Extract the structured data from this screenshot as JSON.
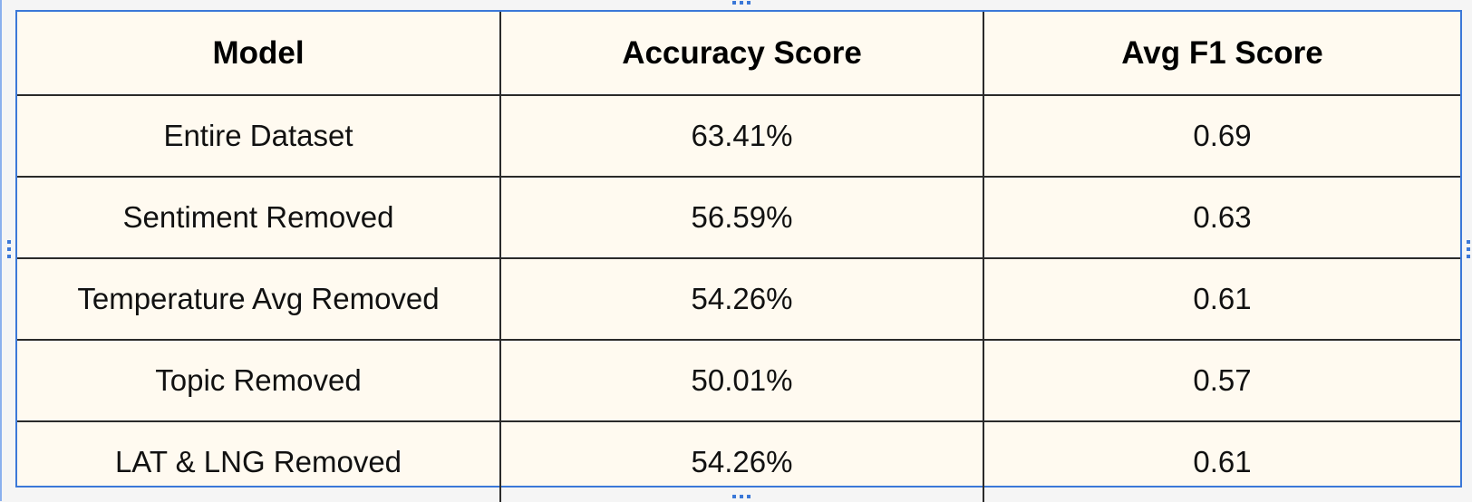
{
  "table": {
    "headers": [
      "Model",
      "Accuracy Score",
      "Avg F1 Score"
    ],
    "rows": [
      [
        "Entire Dataset",
        "63.41%",
        "0.69"
      ],
      [
        "Sentiment Removed",
        "56.59%",
        "0.63"
      ],
      [
        "Temperature Avg Removed",
        "54.26%",
        "0.61"
      ],
      [
        "Topic Removed",
        "50.01%",
        "0.57"
      ],
      [
        "LAT & LNG Removed",
        "54.26%",
        "0.61"
      ]
    ]
  },
  "colors": {
    "selection": "#3b78d8",
    "cell_background": "#fffaf0",
    "border": "#2a2a2a"
  }
}
